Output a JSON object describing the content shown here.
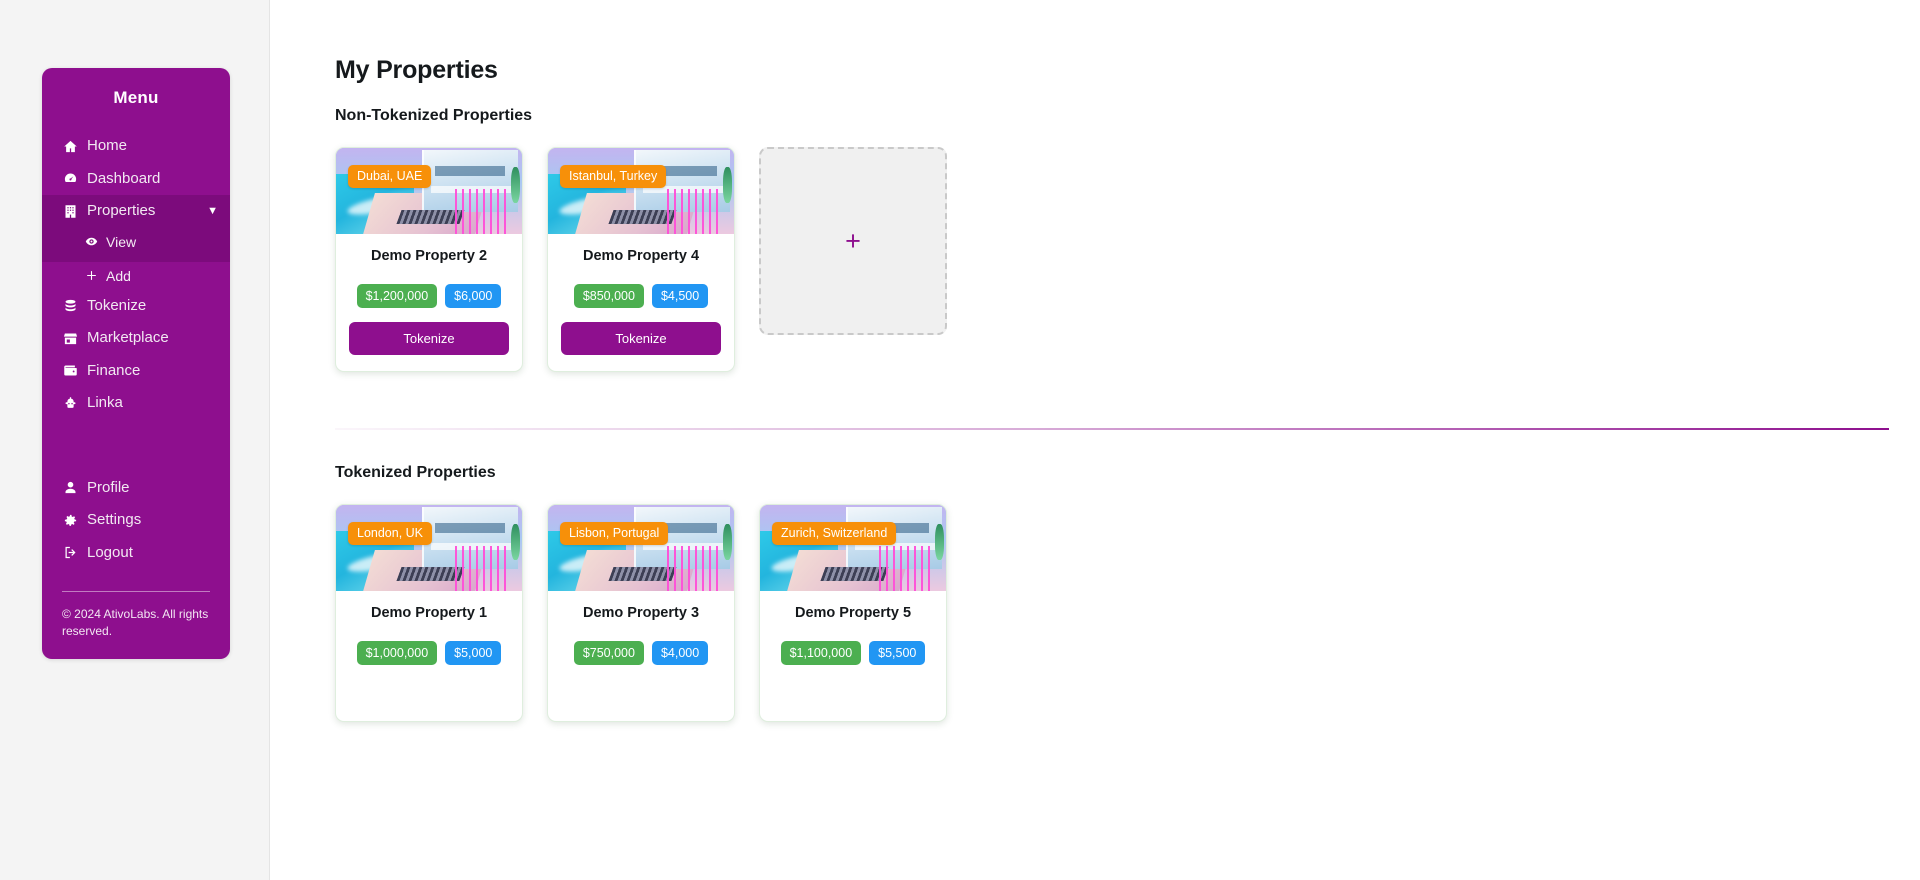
{
  "sidebar": {
    "title": "Menu",
    "items": [
      {
        "label": "Home",
        "icon": "home-icon"
      },
      {
        "label": "Dashboard",
        "icon": "dashboard-icon"
      },
      {
        "label": "Properties",
        "icon": "building-icon",
        "caret": "▼",
        "active": true
      },
      {
        "label": "Tokenize",
        "icon": "coins-icon"
      },
      {
        "label": "Marketplace",
        "icon": "store-icon"
      },
      {
        "label": "Finance",
        "icon": "wallet-icon"
      },
      {
        "label": "Linka",
        "icon": "robot-icon"
      }
    ],
    "submenu": [
      {
        "label": "View",
        "icon": "eye-icon"
      },
      {
        "label": "Add",
        "icon": "plus-icon"
      }
    ],
    "account": [
      {
        "label": "Profile",
        "icon": "user-icon"
      },
      {
        "label": "Settings",
        "icon": "gear-icon"
      },
      {
        "label": "Logout",
        "icon": "logout-icon"
      }
    ],
    "copyright": "© 2024 AtivoLabs. All rights reserved."
  },
  "main": {
    "page_title": "My Properties",
    "sections": [
      {
        "title": "Non-Tokenized Properties",
        "add_card_label": "+",
        "cards": [
          {
            "location": "Dubai, UAE",
            "name": "Demo Property 2",
            "price": "$1,200,000",
            "rent": "$6,000",
            "action": "Tokenize"
          },
          {
            "location": "Istanbul, Turkey",
            "name": "Demo Property 4",
            "price": "$850,000",
            "rent": "$4,500",
            "action": "Tokenize"
          }
        ]
      },
      {
        "title": "Tokenized Properties",
        "cards": [
          {
            "location": "London, UK",
            "name": "Demo Property 1",
            "price": "$1,000,000",
            "rent": "$5,000"
          },
          {
            "location": "Lisbon, Portugal",
            "name": "Demo Property 3",
            "price": "$750,000",
            "rent": "$4,000"
          },
          {
            "location": "Zurich, Switzerland",
            "name": "Demo Property 5",
            "price": "$1,100,000",
            "rent": "$5,500"
          }
        ]
      }
    ]
  },
  "colors": {
    "brand_purple": "#8e0f8e",
    "brand_purple_dark": "#7c0b7c",
    "badge_green": "#4caf50",
    "badge_blue": "#2196f3",
    "badge_orange": "#f79009",
    "rail_bg": "#f4f4f4"
  }
}
